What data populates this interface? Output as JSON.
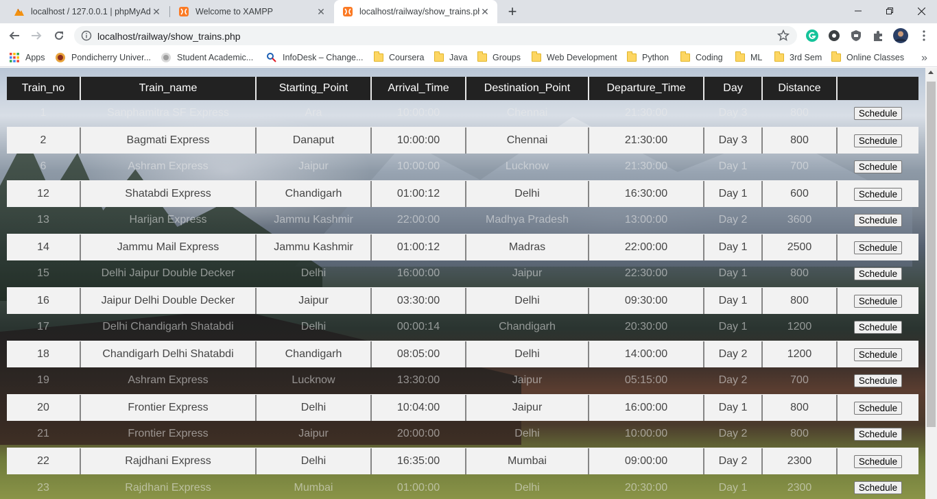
{
  "browser": {
    "tabs": [
      {
        "title": "localhost / 127.0.0.1 | phpMyAdmin",
        "favicon": "phpmyadmin-icon",
        "active": false
      },
      {
        "title": "Welcome to XAMPP",
        "favicon": "xampp-icon",
        "active": false
      },
      {
        "title": "localhost/railway/show_trains.php",
        "favicon": "xampp-icon",
        "active": true
      }
    ],
    "new_tab": "+",
    "url": "localhost/railway/show_trains.php",
    "bookmarks": [
      {
        "label": "Apps",
        "icon": "apps-grid-icon"
      },
      {
        "label": "Pondicherry Univer...",
        "icon": "university-icon"
      },
      {
        "label": "Student Academic...",
        "icon": "academic-icon"
      },
      {
        "label": "InfoDesk – Change...",
        "icon": "infodesk-icon"
      },
      {
        "label": "Coursera",
        "icon": "folder-icon"
      },
      {
        "label": "Java",
        "icon": "folder-icon"
      },
      {
        "label": "Groups",
        "icon": "folder-icon"
      },
      {
        "label": "Web Development",
        "icon": "folder-icon"
      },
      {
        "label": "Python",
        "icon": "folder-icon"
      },
      {
        "label": "Coding",
        "icon": "folder-icon"
      },
      {
        "label": "ML",
        "icon": "folder-icon"
      },
      {
        "label": "3rd Sem",
        "icon": "folder-icon"
      },
      {
        "label": "Online Classes",
        "icon": "folder-icon"
      }
    ],
    "more_bookmarks": "»"
  },
  "table": {
    "headers": [
      "Train_no",
      "Train_name",
      "Starting_Point",
      "Arrival_Time",
      "Destination_Point",
      "Departure_Time",
      "Day",
      "Distance",
      ""
    ],
    "button_label": "Schedule",
    "rows": [
      [
        "1",
        "Sanphamitra SF Express",
        "Ara",
        "10:00:00",
        "Chennai",
        "21:30:00",
        "Day 3",
        "800"
      ],
      [
        "2",
        "Bagmati Express",
        "Danaput",
        "10:00:00",
        "Chennai",
        "21:30:00",
        "Day 3",
        "800"
      ],
      [
        "6",
        "Ashram Express",
        "Jaipur",
        "10:00:00",
        "Lucknow",
        "21:30:00",
        "Day 1",
        "700"
      ],
      [
        "12",
        "Shatabdi Express",
        "Chandigarh",
        "01:00:12",
        "Delhi",
        "16:30:00",
        "Day 1",
        "600"
      ],
      [
        "13",
        "Harijan Express",
        "Jammu Kashmir",
        "22:00:00",
        "Madhya Pradesh",
        "13:00:00",
        "Day 2",
        "3600"
      ],
      [
        "14",
        "Jammu Mail Express",
        "Jammu Kashmir",
        "01:00:12",
        "Madras",
        "22:00:00",
        "Day 1",
        "2500"
      ],
      [
        "15",
        "Delhi Jaipur Double Decker",
        "Delhi",
        "16:00:00",
        "Jaipur",
        "22:30:00",
        "Day 1",
        "800"
      ],
      [
        "16",
        "Jaipur Delhi Double Decker",
        "Jaipur",
        "03:30:00",
        "Delhi",
        "09:30:00",
        "Day 1",
        "800"
      ],
      [
        "17",
        "Delhi Chandigarh Shatabdi",
        "Delhi",
        "00:00:14",
        "Chandigarh",
        "20:30:00",
        "Day 1",
        "1200"
      ],
      [
        "18",
        "Chandigarh Delhi Shatabdi",
        "Chandigarh",
        "08:05:00",
        "Delhi",
        "14:00:00",
        "Day 2",
        "1200"
      ],
      [
        "19",
        "Ashram Express",
        "Lucknow",
        "13:30:00",
        "Jaipur",
        "05:15:00",
        "Day 2",
        "700"
      ],
      [
        "20",
        "Frontier Express",
        "Delhi",
        "10:04:00",
        "Jaipur",
        "16:00:00",
        "Day 1",
        "800"
      ],
      [
        "21",
        "Frontier Express",
        "Jaipur",
        "20:00:00",
        "Delhi",
        "10:00:00",
        "Day 2",
        "800"
      ],
      [
        "22",
        "Rajdhani Express",
        "Delhi",
        "16:35:00",
        "Mumbai",
        "09:00:00",
        "Day 2",
        "2300"
      ],
      [
        "23",
        "Rajdhani Express",
        "Mumbai",
        "01:00:00",
        "Delhi",
        "20:30:00",
        "Day 1",
        "2300"
      ]
    ]
  }
}
